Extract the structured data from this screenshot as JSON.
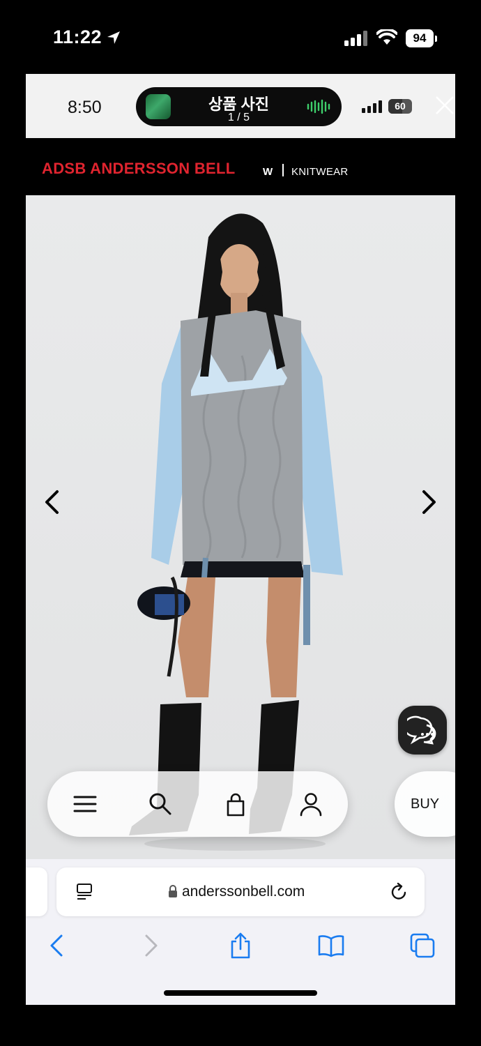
{
  "os_status": {
    "time": "11:22",
    "battery": "94"
  },
  "inner_status": {
    "time": "8:50",
    "battery": "60"
  },
  "island": {
    "title": "상품 사진",
    "subtitle": "1 / 5"
  },
  "header": {
    "brand": "ADSB  ANDERSSON BELL",
    "gender": "W",
    "category": "KNITWEAR"
  },
  "gallery": {
    "prev_icon": "chevron-left-icon",
    "next_icon": "chevron-right-icon"
  },
  "nav": {
    "items": [
      "menu-icon",
      "search-icon",
      "bag-icon",
      "account-icon"
    ],
    "buy_label": "BUY"
  },
  "browser": {
    "url": "anderssonbell.com"
  },
  "colors": {
    "brand_red": "#e0242f",
    "ios_blue": "#1a7cf0",
    "header_bg": "#000000"
  }
}
